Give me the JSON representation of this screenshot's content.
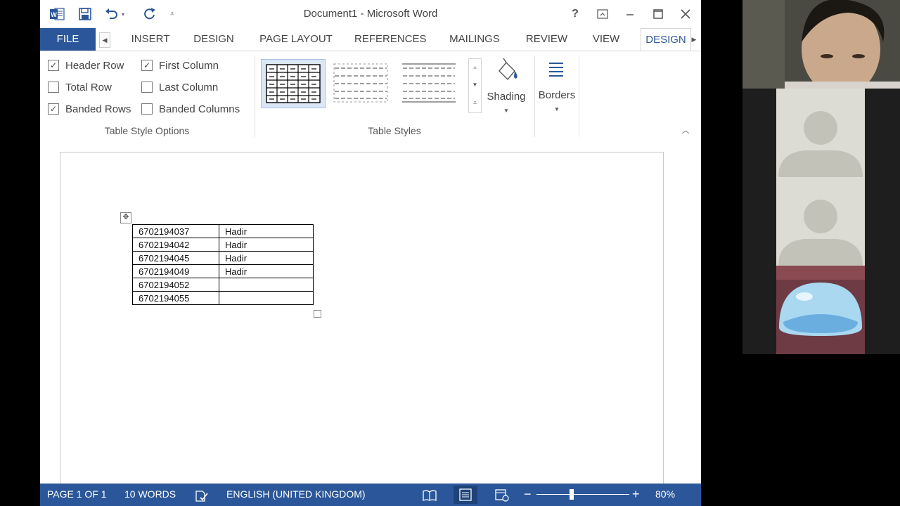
{
  "window": {
    "title": "Document1 - Microsoft Word",
    "help_glyph": "?"
  },
  "tabs": {
    "file": "FILE",
    "insert": "INSERT",
    "design": "DESIGN",
    "page_layout": "PAGE LAYOUT",
    "references": "REFERENCES",
    "mailings": "MAILINGS",
    "review": "REVIEW",
    "view": "VIEW",
    "table_design": "DESIGN"
  },
  "table_style_options": {
    "header_row": {
      "label": "Header Row",
      "checked": true
    },
    "first_column": {
      "label": "First Column",
      "checked": true
    },
    "total_row": {
      "label": "Total Row",
      "checked": false
    },
    "last_column": {
      "label": "Last Column",
      "checked": false
    },
    "banded_rows": {
      "label": "Banded Rows",
      "checked": true
    },
    "banded_columns": {
      "label": "Banded Columns",
      "checked": false
    },
    "group_label": "Table Style Options"
  },
  "table_styles": {
    "group_label": "Table Styles",
    "shading_label": "Shading",
    "borders_label": "Borders"
  },
  "document_table": [
    {
      "id": "6702194037",
      "status": "Hadir"
    },
    {
      "id": "6702194042",
      "status": "Hadir"
    },
    {
      "id": "6702194045",
      "status": "Hadir"
    },
    {
      "id": "6702194049",
      "status": "Hadir"
    },
    {
      "id": "6702194052",
      "status": ""
    },
    {
      "id": "6702194055",
      "status": ""
    }
  ],
  "statusbar": {
    "page": "PAGE 1 OF 1",
    "words": "10 WORDS",
    "language": "ENGLISH (UNITED KINGDOM)",
    "zoom": "80%",
    "zoom_percent": 80
  },
  "colors": {
    "accent": "#2b579a",
    "active_tab_text": "#2b579a"
  }
}
